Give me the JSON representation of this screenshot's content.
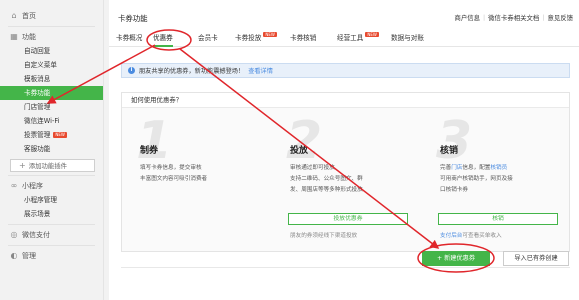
{
  "sidebar": {
    "home": "首页",
    "function_section": "功能",
    "items": [
      {
        "label": "自动回复"
      },
      {
        "label": "自定义菜单"
      },
      {
        "label": "模板消息"
      },
      {
        "label": "卡券功能",
        "active": true
      },
      {
        "label": "门店管理"
      },
      {
        "label": "微信连Wi-Fi"
      },
      {
        "label": "投票管理",
        "badge": "NEW"
      },
      {
        "label": "客服功能"
      }
    ],
    "add_plugin": "添加功能插件",
    "mini_section": "小程序",
    "mini_items": [
      {
        "label": "小程序管理"
      },
      {
        "label": "展示场景"
      }
    ],
    "pay_section": "微信支付",
    "bottom_section": "管理"
  },
  "header": {
    "title": "卡券功能",
    "links": [
      "商户信息",
      "微信卡券相关文档",
      "意见反馈"
    ]
  },
  "tabs": [
    {
      "label": "卡券概况"
    },
    {
      "label": "优惠券",
      "active": true
    },
    {
      "label": "会员卡"
    },
    {
      "label": "卡券投放",
      "badge": "NEW"
    },
    {
      "label": "卡券核销"
    },
    {
      "label": "经营工具",
      "badge": "NEW"
    },
    {
      "label": "数据与对账"
    }
  ],
  "notice": {
    "text": "朋友共享的优惠券，新功能震撼登场！",
    "link": "查看详情"
  },
  "howto": {
    "heading": "如何使用优惠券？",
    "steps": [
      {
        "num": "1",
        "title": "制券",
        "desc1": "填写卡券信息，提交审核",
        "desc2": "丰富图文内容可吸引消费者"
      },
      {
        "num": "2",
        "title": "投放",
        "desc1": "审核通过即可投放",
        "desc2": "支持二维码、公众号图文、群",
        "desc3": "发、周围店等等多种形式投放",
        "button": "投放优惠券",
        "sub": "朋友的券须经线下渠道投放"
      },
      {
        "num": "3",
        "title": "核销",
        "desc1_pre": "完善",
        "desc1_link1": "门店",
        "desc1_mid": "信息，配置",
        "desc1_link2": "核销员",
        "desc2": "可用商户核销助手，网页及接",
        "desc3": "口核销卡券",
        "button": "核销",
        "sub_link": "支付后台",
        "sub_rest": "可查看买单收入"
      }
    ]
  },
  "actions": {
    "primary": "新建优惠券",
    "secondary": "导入已有券创建"
  },
  "colors": {
    "accent": "#44b549",
    "annotation": "#e0262b",
    "link": "#4a8be0"
  }
}
